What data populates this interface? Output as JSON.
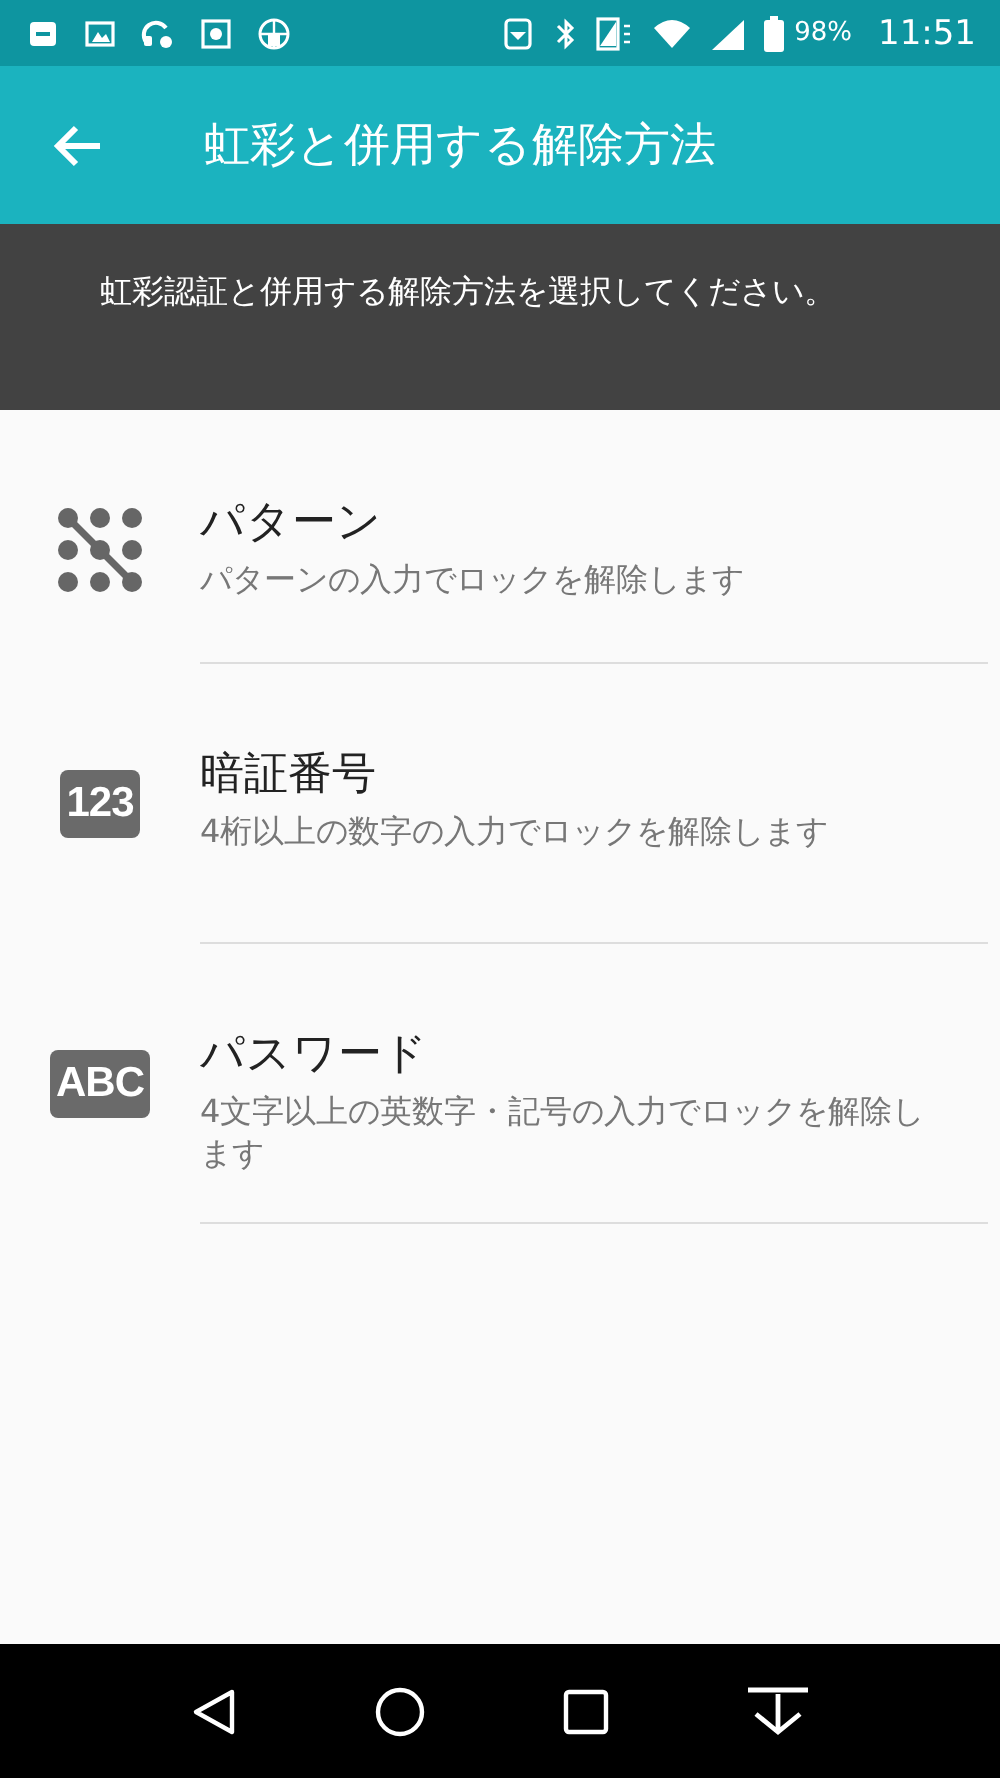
{
  "status_bar": {
    "battery_percent": "98%",
    "time": "11:51"
  },
  "app_bar": {
    "title": "虹彩と併用する解除方法"
  },
  "description": "虹彩認証と併用する解除方法を選択してください。",
  "options": [
    {
      "kind": "pattern",
      "title": "パターン",
      "subtitle": "パターンの入力でロックを解除します"
    },
    {
      "kind": "badge",
      "badge": "123",
      "title": "暗証番号",
      "subtitle": "4桁以上の数字の入力でロックを解除します"
    },
    {
      "kind": "badge",
      "badge": "ABC",
      "title": "パスワード",
      "subtitle": "4文字以上の英数字・記号の入力でロックを解除します"
    }
  ]
}
